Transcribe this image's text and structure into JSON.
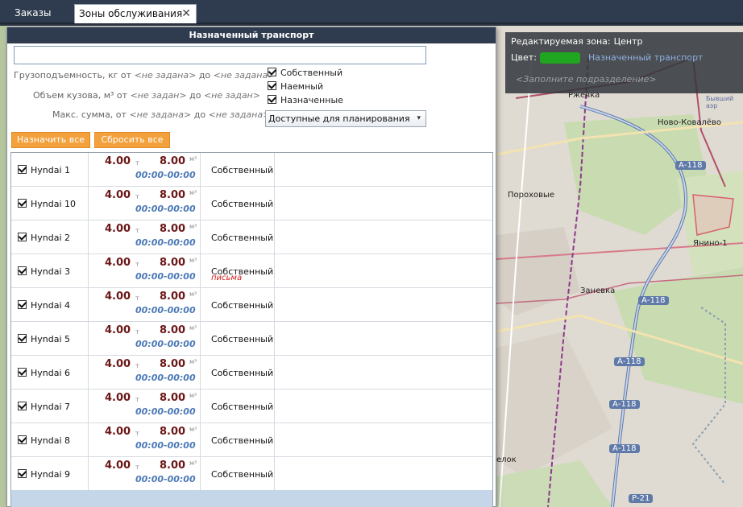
{
  "tabs": [
    {
      "label": "Заказы"
    },
    {
      "label": "Зоны обслуживания"
    }
  ],
  "zone_info": {
    "zone_label": "Редактируемая зона:",
    "zone_name": "Центр",
    "color_label": "Цвет:",
    "color": "#1fa51f",
    "transport_link": "Назначенный транспорт",
    "subdivision_placeholder": "<Заполните подразделение>"
  },
  "map": {
    "labels": [
      "Ржевка",
      "Ново-Ковалёво",
      "А-118",
      "Пороховые",
      "Янино-1",
      "Заневка",
      "Р-21",
      "елок",
      "Бывший аэр"
    ]
  },
  "dialog": {
    "title": "Назначенный транспорт",
    "search_value": "",
    "filters": {
      "capacity": {
        "label": "Грузоподъемность, кг от",
        "from": "<не задана>",
        "to_label": "до",
        "to": "<не задана>"
      },
      "volume": {
        "label": "Объем кузова, м³ от",
        "from": "<не задан>",
        "to_label": "до",
        "to": "<не задан>"
      },
      "sum": {
        "label": "Макс. сумма,  от",
        "from": "<не задана>",
        "to_label": "до",
        "to": "<не задана>"
      }
    },
    "checkboxes": [
      {
        "label": "Собственный",
        "checked": true
      },
      {
        "label": "Наемный",
        "checked": true
      },
      {
        "label": "Назначенные",
        "checked": true
      }
    ],
    "availability_select": "Доступные для планирования",
    "buttons": {
      "assign_all": "Назначить все",
      "reset_all": "Сбросить все"
    },
    "units": {
      "capacity": "т",
      "volume": "м³"
    },
    "vehicles": [
      {
        "name": "Hyndai 1",
        "checked": true,
        "capacity": "4.00",
        "volume": "8.00",
        "time": "00:00-00:00",
        "type": "Собственный",
        "note": ""
      },
      {
        "name": "Hyndai 10",
        "checked": true,
        "capacity": "4.00",
        "volume": "8.00",
        "time": "00:00-00:00",
        "type": "Собственный",
        "note": ""
      },
      {
        "name": "Hyndai 2",
        "checked": true,
        "capacity": "4.00",
        "volume": "8.00",
        "time": "00:00-00:00",
        "type": "Собственный",
        "note": ""
      },
      {
        "name": "Hyndai 3",
        "checked": true,
        "capacity": "4.00",
        "volume": "8.00",
        "time": "00:00-00:00",
        "type": "Собственный",
        "note": "письма"
      },
      {
        "name": "Hyndai 4",
        "checked": true,
        "capacity": "4.00",
        "volume": "8.00",
        "time": "00:00-00:00",
        "type": "Собственный",
        "note": ""
      },
      {
        "name": "Hyndai 5",
        "checked": true,
        "capacity": "4.00",
        "volume": "8.00",
        "time": "00:00-00:00",
        "type": "Собственный",
        "note": ""
      },
      {
        "name": "Hyndai 6",
        "checked": true,
        "capacity": "4.00",
        "volume": "8.00",
        "time": "00:00-00:00",
        "type": "Собственный",
        "note": ""
      },
      {
        "name": "Hyndai 7",
        "checked": true,
        "capacity": "4.00",
        "volume": "8.00",
        "time": "00:00-00:00",
        "type": "Собственный",
        "note": ""
      },
      {
        "name": "Hyndai 8",
        "checked": true,
        "capacity": "4.00",
        "volume": "8.00",
        "time": "00:00-00:00",
        "type": "Собственный",
        "note": ""
      },
      {
        "name": "Hyndai 9",
        "checked": true,
        "capacity": "4.00",
        "volume": "8.00",
        "time": "00:00-00:00",
        "type": "Собственный",
        "note": ""
      }
    ]
  }
}
